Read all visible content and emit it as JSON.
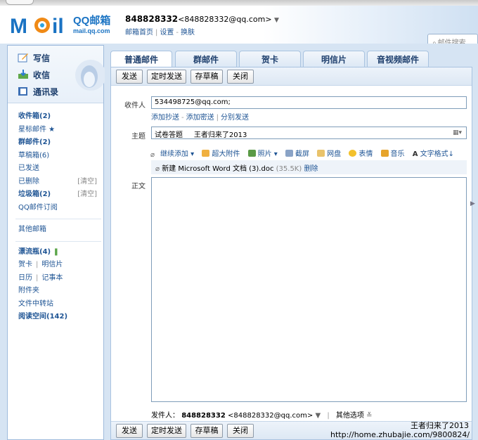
{
  "brand": {
    "logo_text": "MOil",
    "name": "QQ邮箱",
    "domain": "mail.qq.com"
  },
  "account": {
    "qq": "848828332",
    "email": "<848828332@qq.com>",
    "links": [
      "邮箱首页",
      "设置",
      "换肤"
    ]
  },
  "search": {
    "placeholder": "邮件搜索..."
  },
  "sidebar": {
    "quick": [
      "写信",
      "收信",
      "通讯录"
    ],
    "folders": [
      {
        "label": "收件箱(2)",
        "bold": true
      },
      {
        "label": "星标邮件 ★",
        "bold": false
      },
      {
        "label": "群邮件(2)",
        "bold": true
      },
      {
        "label": "草稿箱(6)",
        "bold": false
      },
      {
        "label": "已发送",
        "bold": false
      },
      {
        "label": "已删除",
        "bold": false,
        "extra": "[清空]"
      },
      {
        "label": "垃圾箱(2)",
        "bold": true,
        "extra": "[清空]"
      },
      {
        "label": "QQ邮件订阅",
        "bold": false
      }
    ],
    "other": "其他邮箱",
    "apps": [
      {
        "label": "漂流瓶(4)",
        "bold": true
      },
      {
        "label": "贺卡",
        "label2": "明信片"
      },
      {
        "label": "日历",
        "label2": "记事本"
      },
      {
        "label": "附件夹"
      },
      {
        "label": "文件中转站"
      },
      {
        "label": "阅读空间(142)",
        "bold": true
      }
    ]
  },
  "tabs": [
    "普通邮件",
    "群邮件",
    "贺卡",
    "明信片",
    "音视频邮件"
  ],
  "toolbar": {
    "send": "发送",
    "timed_send": "定时发送",
    "save_draft": "存草稿",
    "close": "关闭"
  },
  "compose": {
    "to_label": "收件人",
    "to_value": "534498725@qq.com;",
    "cc_links": [
      "添加抄送",
      "添加密送",
      "分别发送"
    ],
    "subject_label": "主题",
    "subject_value": "试卷答题     王者归来了2013",
    "tools": [
      "继续添加",
      "超大附件",
      "照片",
      "截屏",
      "网盘",
      "表情",
      "音乐",
      "文字格式"
    ],
    "attachment_name": "新建 Microsoft Word 文档 (3).doc",
    "attachment_size": "(35.5K)",
    "attachment_delete": "删除",
    "body_label": "正文",
    "sender_label": "发件人：",
    "sender_qq": "848828332",
    "sender_email": "<848828332@qq.com>",
    "other_options": "其他选项"
  },
  "watermark": {
    "line1": "王者归来了2013",
    "line2": "http://home.zhubajie.com/9800824/"
  },
  "colors": {
    "accent": "#1e5494",
    "frame": "#d6e4f3",
    "border": "#a9c3e0"
  }
}
